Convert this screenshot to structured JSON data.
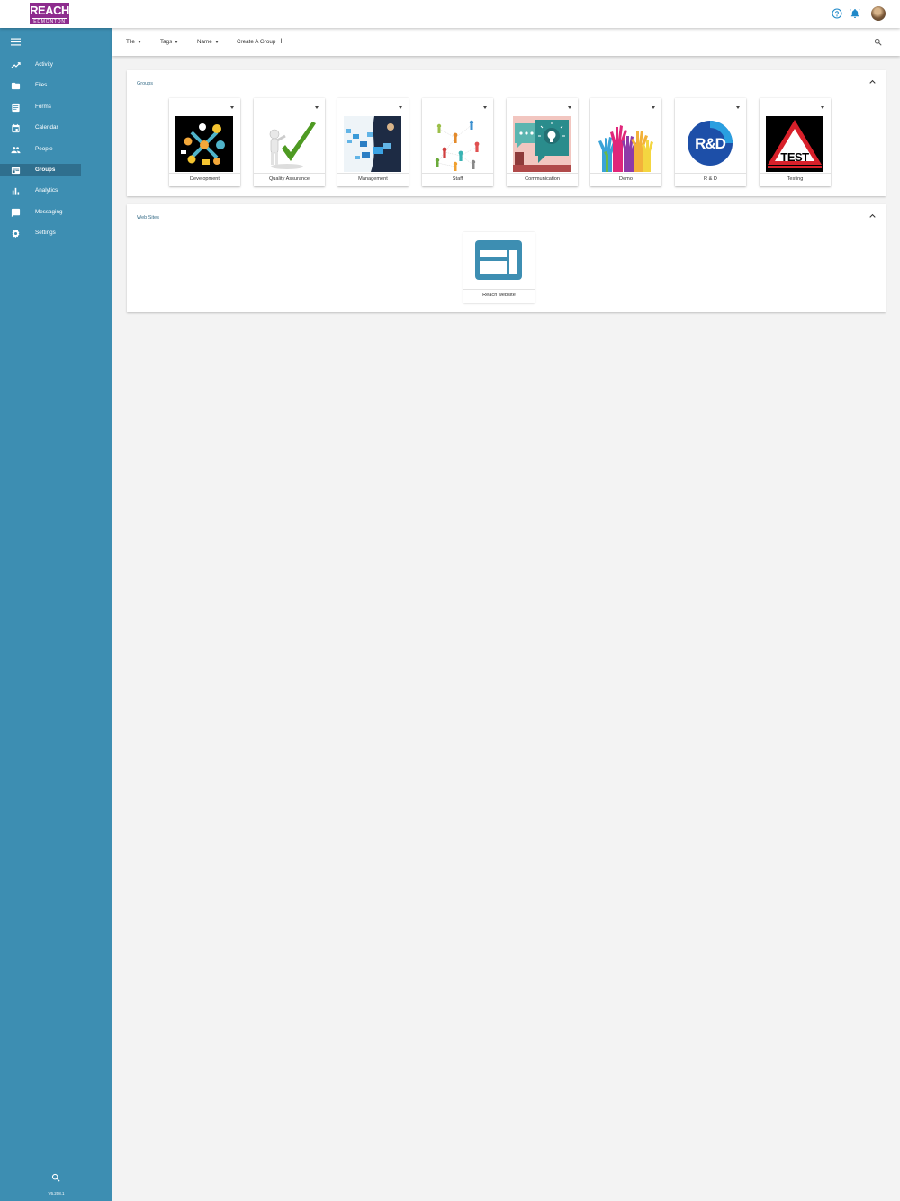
{
  "header": {
    "logo_main": "REACH",
    "logo_sub": "EDMONTON",
    "icons": [
      "help-circle-icon",
      "notification-bell-icon",
      "user-avatar"
    ]
  },
  "sidebar": {
    "menu_icon": "hamburger-menu-icon",
    "items": [
      {
        "label": "Activity",
        "icon": "trending-line-icon",
        "active": false
      },
      {
        "label": "Files",
        "icon": "folder-icon",
        "active": false
      },
      {
        "label": "Forms",
        "icon": "form-document-icon",
        "active": false
      },
      {
        "label": "Calendar",
        "icon": "calendar-icon",
        "active": false
      },
      {
        "label": "People",
        "icon": "people-icon",
        "active": false
      },
      {
        "label": "Groups",
        "icon": "groups-card-icon",
        "active": true
      },
      {
        "label": "Analytics",
        "icon": "bar-chart-icon",
        "active": false
      },
      {
        "label": "Messaging",
        "icon": "chat-bubble-icon",
        "active": false
      },
      {
        "label": "Settings",
        "icon": "gear-icon",
        "active": false
      }
    ],
    "version": "V6.208.1"
  },
  "toolbar": {
    "tile_label": "Tile",
    "tags_label": "Tags",
    "name_label": "Name",
    "create_label": "Create A Group"
  },
  "groups": {
    "title": "Groups",
    "items": [
      {
        "label": "Development"
      },
      {
        "label": "Quality Assurance"
      },
      {
        "label": "Management"
      },
      {
        "label": "Staff"
      },
      {
        "label": "Communication"
      },
      {
        "label": "Demo"
      },
      {
        "label": "R & D",
        "image_text": "R&D"
      },
      {
        "label": "Testing",
        "image_text": "TEST"
      }
    ]
  },
  "websites": {
    "title": "Web Sites",
    "items": [
      {
        "label": "Reach website"
      }
    ]
  },
  "colors": {
    "sidebar": "#3d8eb2",
    "sidebar_active": "#2f6f8e",
    "logo": "#8e2c8e",
    "accent": "#1e88c8"
  }
}
